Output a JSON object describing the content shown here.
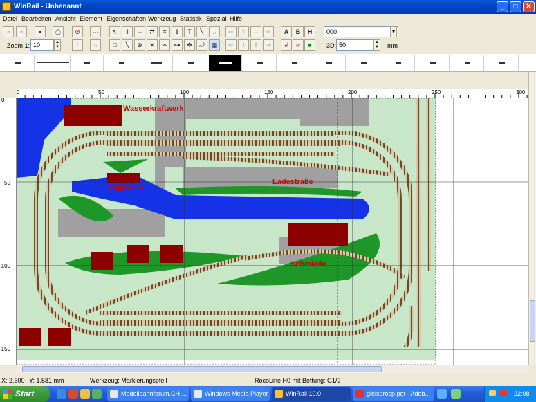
{
  "window": {
    "title": "WinRail - Unbenannt",
    "min": "_",
    "max": "□",
    "close": "✕"
  },
  "menu": [
    "Datei",
    "Bearbeiten",
    "Ansicht",
    "Element",
    "Eigenschaften",
    "Werkzeug",
    "Statistik",
    "Spezial",
    "Hilfe"
  ],
  "toolbar": {
    "zoom_label": "Zoom 1:",
    "zoom_value": "10",
    "color_value": "000",
    "three_d_label": "3D:",
    "three_d_value": "50",
    "unit": "mm",
    "text_buttons": [
      "A",
      "B",
      "H"
    ]
  },
  "ruler": {
    "h_ticks": [
      "0",
      "50",
      "100",
      "150",
      "200",
      "250",
      "300"
    ],
    "v_ticks": [
      "0",
      "50",
      "-100",
      "-150"
    ]
  },
  "layout_labels": {
    "wasserkraftwerk": "Wasserkraftwerk",
    "saegewerk": "Sägewerk",
    "ladestrasse": "Ladestraße",
    "schmiede": "Schmiede"
  },
  "status": {
    "x": "X: 2.600",
    "y": "Y: 1.581 mm",
    "tool": "Werkzeug: Markierungspfeil",
    "track": "RocoLine H0 mit Bettung: G1/2"
  },
  "taskbar": {
    "start": "Start",
    "tasks": [
      "Modellbahnforum.CH ...",
      "Windows Media Player",
      "WinRail 10.0",
      "gleisprosp.pdf - Adob..."
    ],
    "clock": "22:08"
  },
  "colors": {
    "ground": "#c8e6c8",
    "water": "#1432e6",
    "grass": "#1e9628",
    "building": "#8c0000",
    "road": "#a0a0a0"
  }
}
